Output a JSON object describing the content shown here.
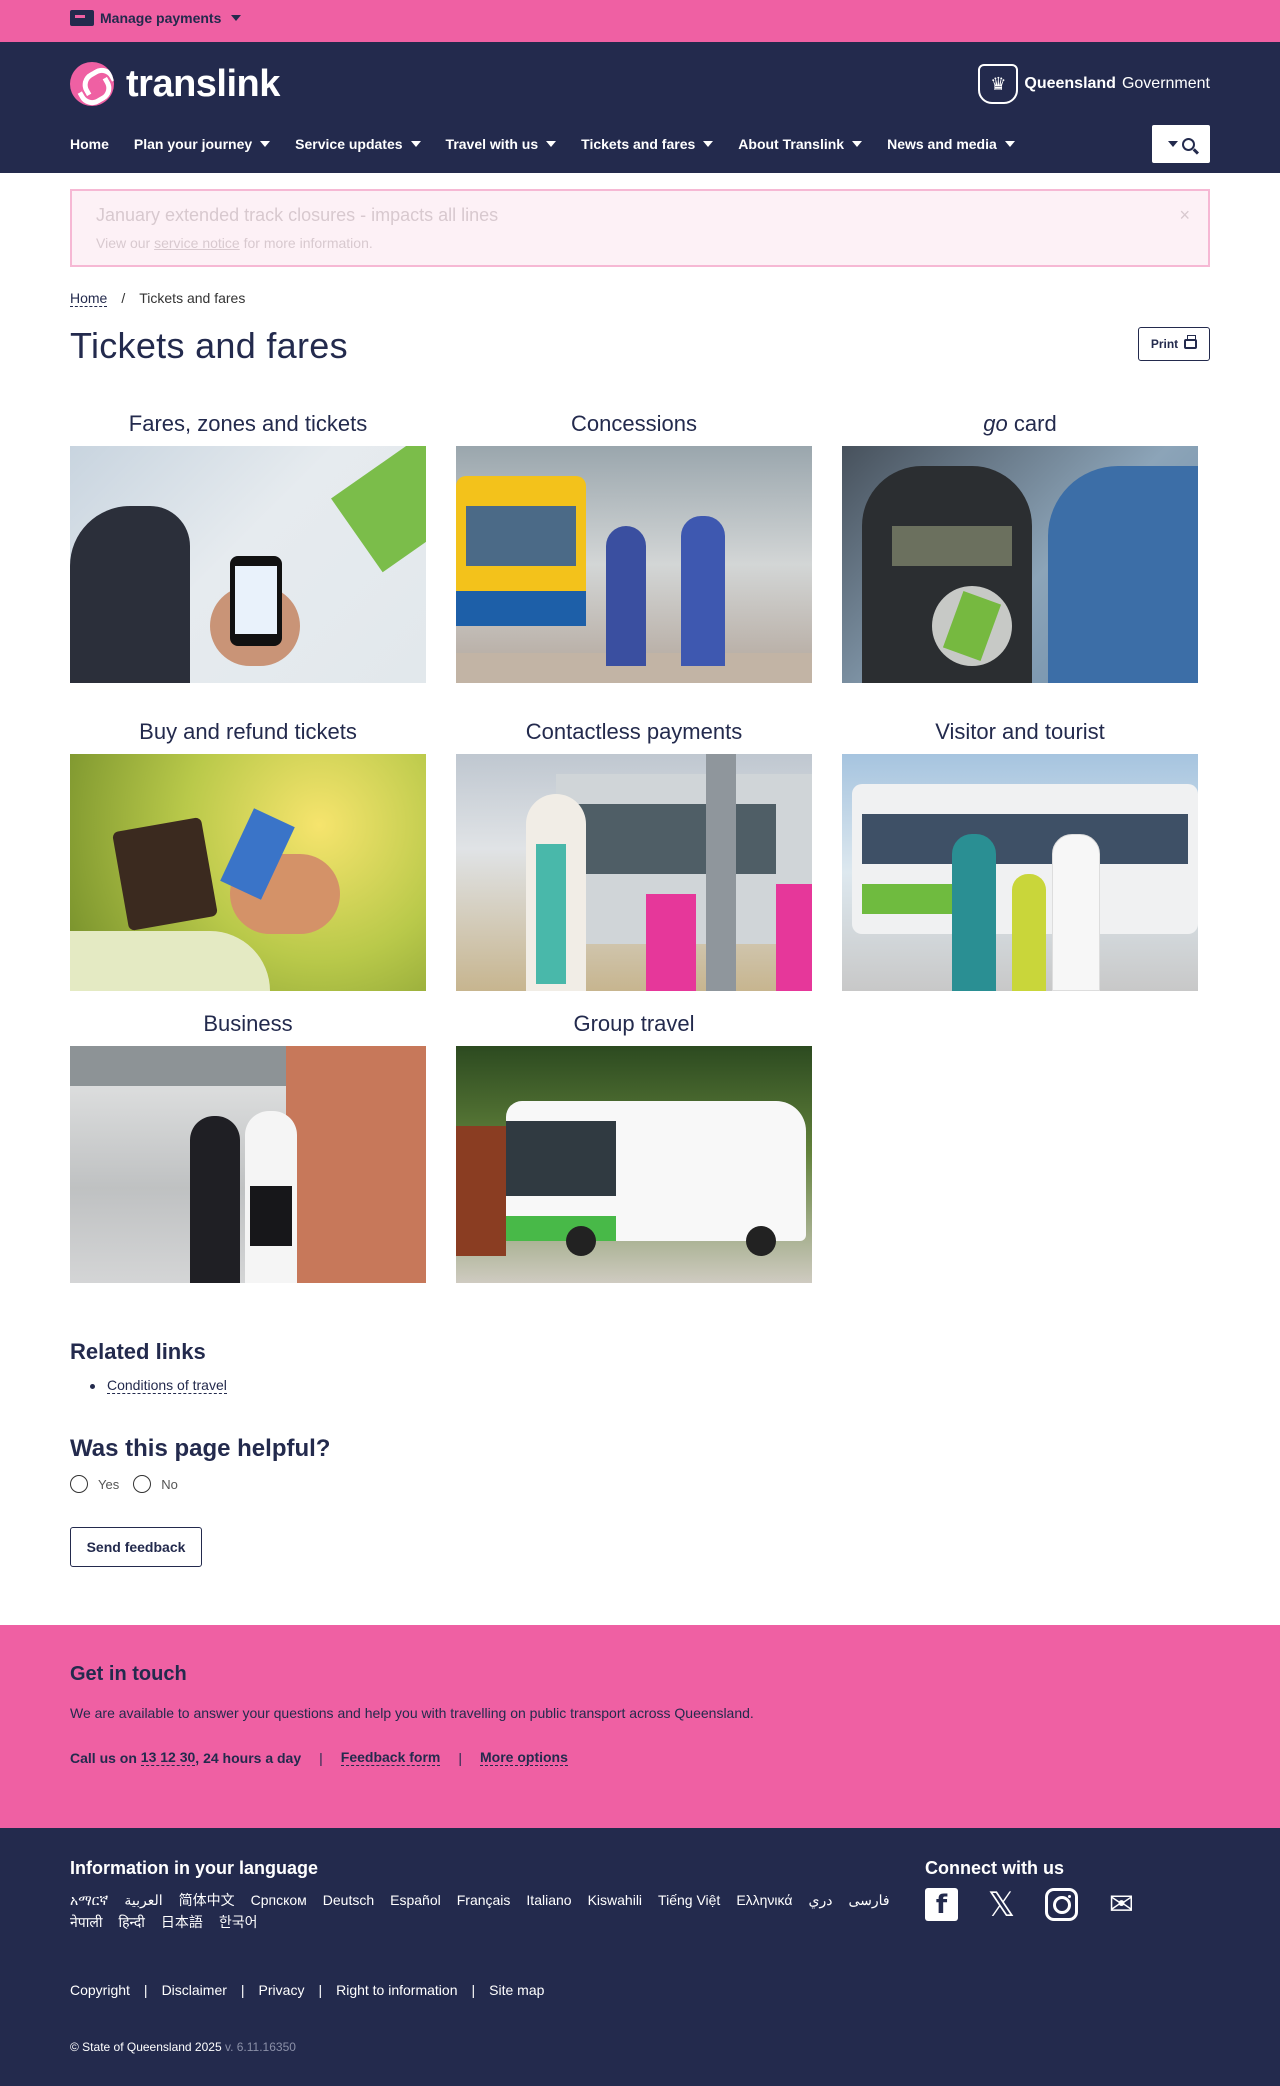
{
  "topbar": {
    "manage_payments": "Manage payments"
  },
  "header": {
    "logo_text": "translink",
    "qgov_bold": "Queensland",
    "qgov_rest": "Government",
    "nav": [
      {
        "label": "Home"
      },
      {
        "label": "Plan your journey"
      },
      {
        "label": "Service updates"
      },
      {
        "label": "Travel with us"
      },
      {
        "label": "Tickets and fares"
      },
      {
        "label": "About Translink"
      },
      {
        "label": "News and media"
      }
    ]
  },
  "alert": {
    "title": "January extended track closures - impacts all lines",
    "text_before": "View our",
    "link": "service notice",
    "text_after": "for more information.",
    "close": "×"
  },
  "breadcrumb": {
    "home": "Home",
    "separator": "/",
    "current": "Tickets and fares"
  },
  "page": {
    "title": "Tickets and fares",
    "print": "Print"
  },
  "tiles": [
    {
      "title": "Fares, zones and tickets"
    },
    {
      "title": "Concessions"
    },
    {
      "title_italic": "go",
      "title_rest": "card"
    },
    {
      "title": "Buy and refund tickets"
    },
    {
      "title": "Contactless payments"
    },
    {
      "title": "Visitor and tourist"
    },
    {
      "title": "Business"
    },
    {
      "title": "Group travel"
    }
  ],
  "related": {
    "title": "Related links",
    "links": [
      "Conditions of travel"
    ]
  },
  "helpful": {
    "title": "Was this page helpful?",
    "yes": "Yes",
    "no": "No",
    "button": "Send feedback"
  },
  "touch": {
    "title": "Get in touch",
    "text": "We are available to answer your questions and help you with travelling on public transport across Queensland.",
    "call_prefix": "Call us on",
    "phone": "13 12 30",
    "call_suffix": ", 24 hours a day",
    "feedback": "Feedback form",
    "more": "More options",
    "sep": "|"
  },
  "footer": {
    "lang_title": "Information in your language",
    "languages": [
      "አማርኛ",
      "العربية",
      "简体中文",
      "Српском",
      "Deutsch",
      "Español",
      "Français",
      "Italiano",
      "Kiswahili",
      "Tiếng Việt",
      "Ελληνικά",
      "دري",
      "فارسی",
      "नेपाली",
      "हिन्दी",
      "日本語",
      "한국어"
    ],
    "connect_title": "Connect with us",
    "links": [
      "Copyright",
      "Disclaimer",
      "Privacy",
      "Right to information",
      "Site map"
    ],
    "sep": "|",
    "copyright": "© State of Queensland 2025",
    "version": "v. 6.11.16350"
  },
  "colors": {
    "brand_pink": "#ef60a3",
    "navy": "#232a4d"
  },
  "icons": [
    "card-icon",
    "chevron-down-icon",
    "search-icon",
    "close-icon",
    "printer-icon",
    "facebook-icon",
    "x-icon",
    "instagram-icon",
    "email-icon"
  ]
}
